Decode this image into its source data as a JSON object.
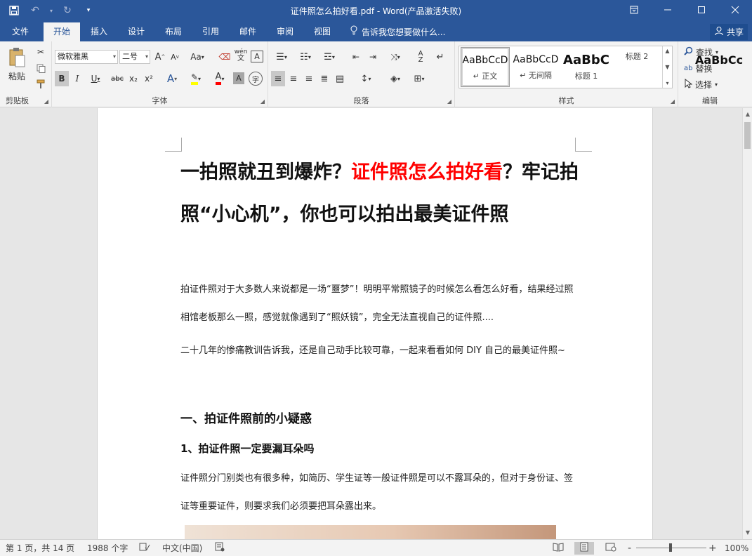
{
  "window": {
    "title": "证件照怎么拍好看.pdf - Word(产品激活失败)",
    "qat_customize": "▾"
  },
  "tabs": [
    "文件",
    "开始",
    "插入",
    "设计",
    "布局",
    "引用",
    "邮件",
    "审阅",
    "视图"
  ],
  "active_tab": "开始",
  "tell_me": "告诉我您想要做什么...",
  "share": "共享",
  "ribbon": {
    "clipboard": {
      "paste": "粘贴",
      "label": "剪贴板"
    },
    "font": {
      "font_name": "微软雅黑",
      "font_size": "二号",
      "grow": "A",
      "shrink": "A",
      "case": "Aa",
      "phonetic": "wén",
      "border_char": "A",
      "bold": "B",
      "italic": "I",
      "underline": "U",
      "strike": "abc",
      "sub": "x₂",
      "sup": "x²",
      "effects": "A",
      "font_color": "A",
      "shading": "A",
      "enclose": "字",
      "label": "字体"
    },
    "paragraph": {
      "label": "段落"
    },
    "styles": {
      "items": [
        {
          "sample": "AaBbCcD",
          "name": "↵ 正文"
        },
        {
          "sample": "AaBbCcD",
          "name": "↵ 无间隔"
        },
        {
          "sample": "AaBbC",
          "name": "标题 1"
        },
        {
          "sample": "AaBbCc",
          "name": "标题 2"
        }
      ],
      "label": "样式"
    },
    "editing": {
      "find": "查找",
      "replace": "替换",
      "select": "选择",
      "label": "编辑"
    }
  },
  "document": {
    "title_part1": "一拍照就丑到爆炸？",
    "title_red": "证件照怎么拍好看",
    "title_part2": "？牢记拍照“小心机”，你也可以拍出最美证件照",
    "para1": "拍证件照对于大多数人来说都是一场“噩梦”！明明平常照镜子的时候怎么看怎么好看，结果经过照相馆老板那么一照，感觉就像遇到了“照妖镜”，完全无法直视自己的证件照....",
    "para2": "二十几年的惨痛教训告诉我，还是自己动手比较可靠，一起来看看如何 DIY 自己的最美证件照~",
    "h1": "一、拍证件照前的小疑惑",
    "h2": "1、拍证件照一定要漏耳朵吗",
    "para3": "证件照分门别类也有很多种，如简历、学生证等一般证件照是可以不露耳朵的，但对于身份证、签证等重要证件，则要求我们必须要把耳朵露出来。"
  },
  "status": {
    "page": "第 1 页，共 14 页",
    "words": "1988 个字",
    "lang": "中文(中国)",
    "zoom_minus": "-",
    "zoom_plus": "+",
    "zoom": "100%"
  },
  "colors": {
    "brand": "#2b579a",
    "accent_red": "#ff0000"
  }
}
